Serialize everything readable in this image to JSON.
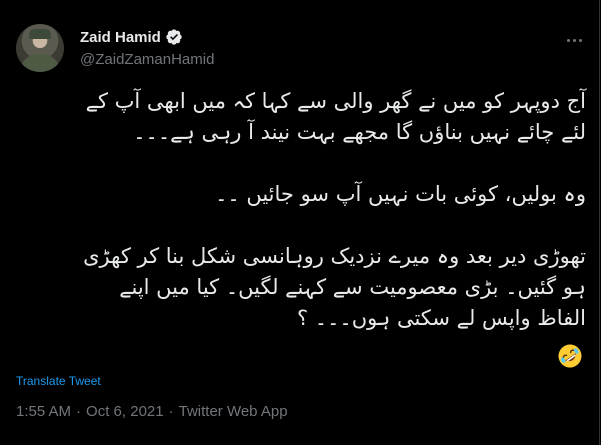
{
  "author": {
    "display_name": "Zaid Hamid",
    "handle": "@ZaidZamanHamid",
    "verified_badge_icon": "verified-badge-icon"
  },
  "tweet": {
    "paragraphs": [
      "آج دوپہر کو میں نے گھر والی سے کہا کہ میں ابھی آپ کے\nلئے چائے نہیں بناؤں گا مجھے بہت نیند آ رہی ہے۔۔۔",
      "وہ بولیں، کوئی بات نہیں آپ سو جائیں ۔۔",
      "تھوڑی دیر بعد وہ میرے نزدیک روہانسی شکل بنا کر کھڑی\nہو گئیں۔ بڑی معصومیت سے کہنے لگیں۔ کیا میں اپنے\nالفاظ واپس لے سکتی ہوں۔۔۔ ؟"
    ],
    "emoji_icon": "rolling-on-floor-laughing-emoji"
  },
  "translate_label": "Translate Tweet",
  "meta": {
    "time": "1:55 AM",
    "sep1": "·",
    "date": "Oct 6, 2021",
    "sep2": "·",
    "source": "Twitter Web App"
  },
  "colors": {
    "background": "#000000",
    "link_blue": "#1d9bf0",
    "secondary_text": "#71767b",
    "primary_text": "#e7e9ea"
  }
}
